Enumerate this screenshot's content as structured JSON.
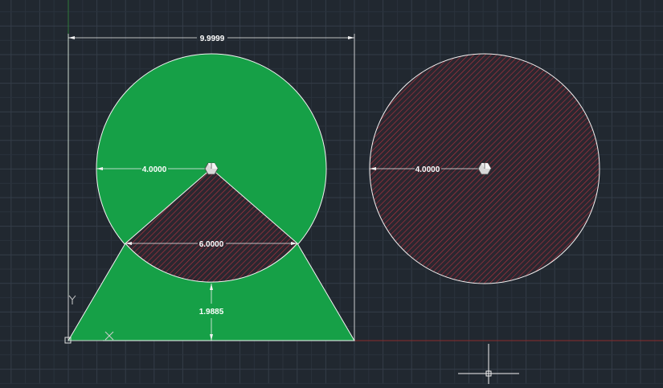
{
  "colors": {
    "background": "#212830",
    "grid_minor": "#2a323c",
    "grid_major": "#343d48",
    "fill_green": "#16a047",
    "hatch_red": "#b8323e",
    "hatch_bg": "#2b2730",
    "line_white": "#f2f2f2",
    "axis_x": "#8a2c2c",
    "axis_y": "#2f7a3a"
  },
  "dimensions": {
    "overall_width": "9.9999",
    "left_radius": "4.0000",
    "chord": "6.0000",
    "height": "1.9885",
    "right_radius": "4.0000"
  },
  "ucs_icon": {
    "x_label": "X",
    "y_label": "Y"
  },
  "icons": {
    "center_marker": "hexagon-center-marker-icon",
    "crosshair": "crosshair-cursor-icon",
    "ucs": "ucs-axis-icon"
  }
}
